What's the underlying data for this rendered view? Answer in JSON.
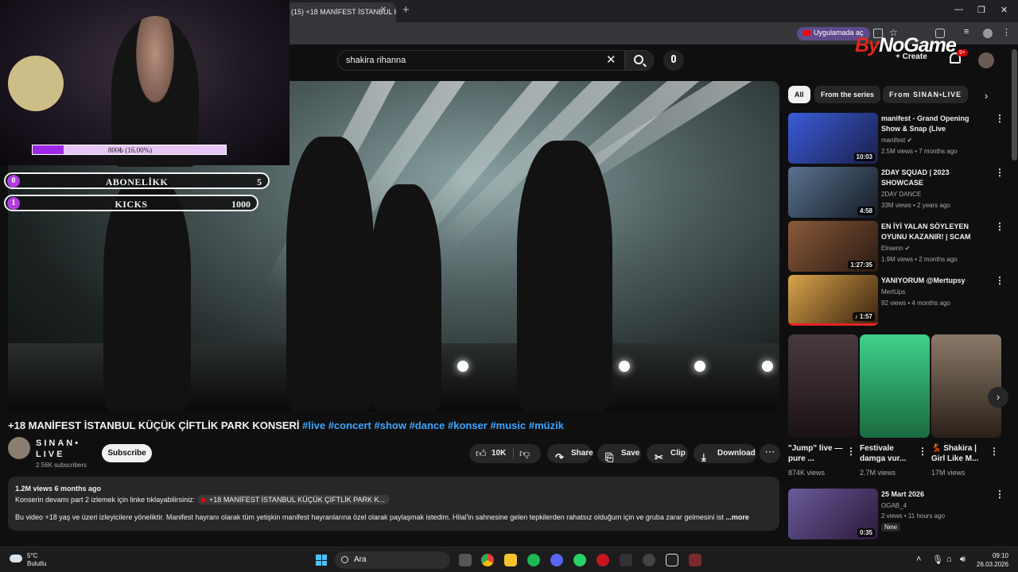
{
  "browser": {
    "tab_title": "(15) +18 MANİFEST İSTANBUL K",
    "open_in_app": "Uygulamada aç"
  },
  "header": {
    "search_query": "shakira rihanna",
    "create_label": "Create",
    "notification_count": "9+",
    "bynogame_logo_a": "By",
    "bynogame_logo_b": "NoGame"
  },
  "overlay": {
    "progress_text": "800₺ (16.00%)",
    "progress_percent": 16,
    "goals": [
      {
        "index": "0",
        "name": "ABONELİKK",
        "value": "5"
      },
      {
        "index": "1",
        "name": "KICKS",
        "value": "1000"
      }
    ]
  },
  "video": {
    "title": "+18 MANİFEST İSTANBUL KÜÇÜK ÇİFTLİK PARK KONSERİ",
    "hashtags": "#live #concert #show #dance #konser #music #müzik",
    "channel_name": "SINAN• LIVE",
    "subscribers": "2.56K subscribers",
    "subscribe_label": "Subscribe",
    "likes": "10K",
    "share_label": "Share",
    "save_label": "Save",
    "clip_label": "Clip",
    "download_label": "Download"
  },
  "description": {
    "views_date": "1.2M views  6 months ago",
    "line1": "Konserin devamı part 2 izlemek için linke tıklayabilirsiniz:",
    "link_text": "+18 MANİFEST İSTANBUL KÜÇÜK ÇİFTLİK PARK K...",
    "line2": "Bu video +18 yaş ve üzeri izleyicilere yöneliktir. Manifest hayranı olarak tüm yetişkin manifest hayranlarına özel olarak paylaşmak istedim. Hilal'in sahnesine gelen tepkilerden rahatsız olduğum için ve gruba zarar gelmesini ist",
    "more_label": "...more"
  },
  "sidebar": {
    "chips": [
      "All",
      "From the series",
      "From SINAN•LIVE"
    ],
    "recommendations": [
      {
        "title": "manifest - Grand Opening Show & Snap (Live Performance) ...",
        "channel": "manifest",
        "meta": "2.5M views • 7 months ago",
        "duration": "10:03",
        "color": "#2b3a8c"
      },
      {
        "title": "2DAY SQUAD | 2023 SHOWCASE",
        "channel": "2DAY DANCE",
        "meta": "33M views • 2 years ago",
        "duration": "4:58",
        "color": "#2c3b52"
      },
      {
        "title": "EN İYİ YALAN SÖYLEYEN OYUNU KAZANIR! | SCAM LIN...",
        "channel": "Elraenn",
        "meta": "1.9M views • 2 months ago",
        "duration": "1:27:35",
        "color": "#5a3a2a"
      },
      {
        "title": "YANIYORUM @Mertupsy",
        "channel": "MertUps",
        "meta": "92 views • 4 months ago",
        "duration": "1:57",
        "color": "#3a2a10"
      }
    ],
    "shorts": [
      {
        "title": "\"Jump\" live — pure ...",
        "views": "874K views",
        "color": "#3c2c34"
      },
      {
        "title": "Festivale damga vur...",
        "views": "2.7M views",
        "color": "#3fd18a"
      },
      {
        "title": "💃 Shakira | Girl Like M...",
        "views": "17M views",
        "color": "#6a5a4a"
      }
    ],
    "last": {
      "title": "25 Mart 2026",
      "channel": "OGAB_4",
      "meta": "2 views • 11 hours ago",
      "duration": "0:35",
      "new_label": "New",
      "color": "#4a3b6a"
    }
  },
  "taskbar": {
    "temp": "5°C",
    "weather": "Bulutlu",
    "search_label": "Ara",
    "time": "09:10",
    "date": "26.03.2026"
  }
}
